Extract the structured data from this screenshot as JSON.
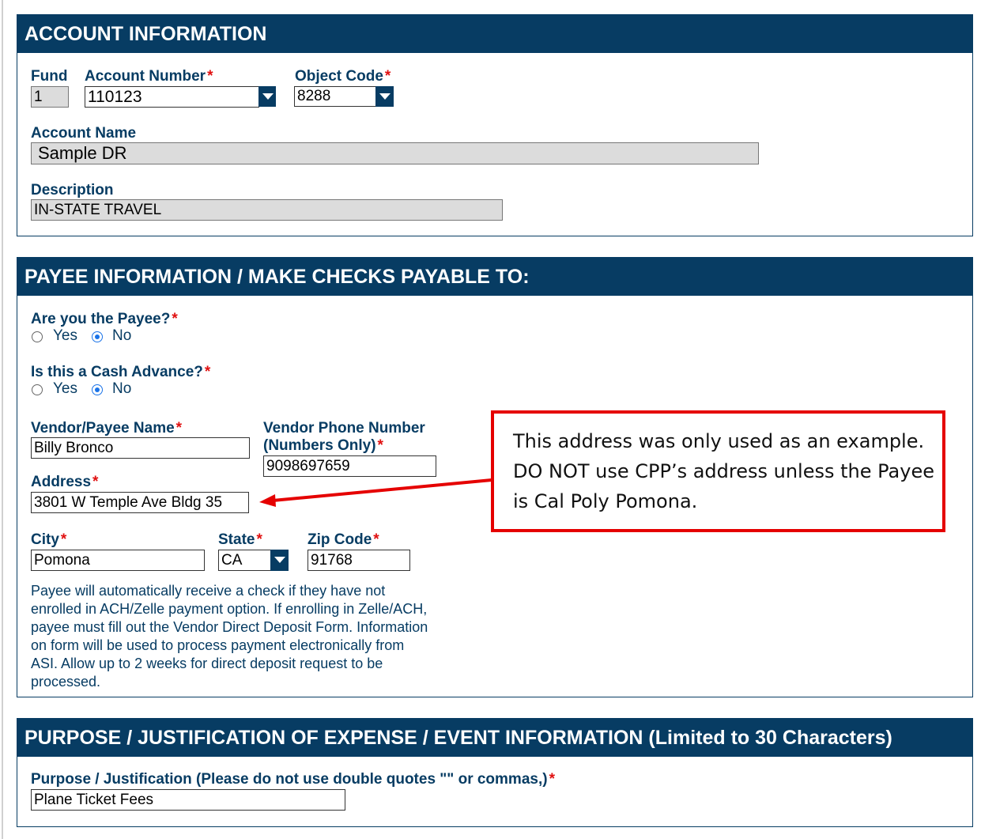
{
  "account": {
    "header": "ACCOUNT INFORMATION",
    "fund_label": "Fund",
    "fund_value": "1",
    "account_number_label": "Account Number",
    "account_number_value": "110123",
    "object_code_label": "Object Code",
    "object_code_value": "8288",
    "account_name_label": "Account Name",
    "account_name_value": "Sample DR",
    "description_label": "Description",
    "description_value": "IN-STATE TRAVEL"
  },
  "payee": {
    "header": "PAYEE INFORMATION / MAKE CHECKS PAYABLE TO:",
    "are_you_payee_label": "Are you the Payee?",
    "are_you_payee_options": [
      "Yes",
      "No"
    ],
    "are_you_payee_selected": "No",
    "cash_advance_label": "Is this a Cash Advance?",
    "cash_advance_options": [
      "Yes",
      "No"
    ],
    "cash_advance_selected": "No",
    "vendor_name_label": "Vendor/Payee Name",
    "vendor_name_value": "Billy Bronco",
    "vendor_phone_label_line1": "Vendor Phone Number",
    "vendor_phone_label_line2": "(Numbers Only)",
    "vendor_phone_value": "9098697659",
    "address_label": "Address",
    "address_value": "3801 W Temple Ave Bldg 35",
    "city_label": "City",
    "city_value": "Pomona",
    "state_label": "State",
    "state_value": "CA",
    "zip_label": "Zip Code",
    "zip_value": "91768",
    "note_lines": [
      "Payee will automatically receive a check if they have not",
      "enrolled in ACH/Zelle payment option. If enrolling in Zelle/ACH,",
      "payee must fill out the Vendor Direct Deposit Form. Information",
      "on form will be used to process payment electronically from",
      "ASI. Allow up to 2 weeks for direct deposit request to be",
      "processed."
    ]
  },
  "purpose": {
    "header": "PURPOSE / JUSTIFICATION OF EXPENSE / EVENT INFORMATION (Limited to 30 Characters)",
    "label": "Purpose / Justification (Please do not use double quotes \"\" or commas,)",
    "value": "Plane Ticket Fees"
  },
  "callout": {
    "lines": [
      "This address was only used as an example.",
      "DO NOT use CPP’s address unless the Payee",
      "is Cal Poly Pomona."
    ]
  },
  "required_mark": "*",
  "colors": {
    "header_bg": "#073c63",
    "label": "#073c63",
    "required": "#e01010",
    "callout_border": "#e50000"
  }
}
